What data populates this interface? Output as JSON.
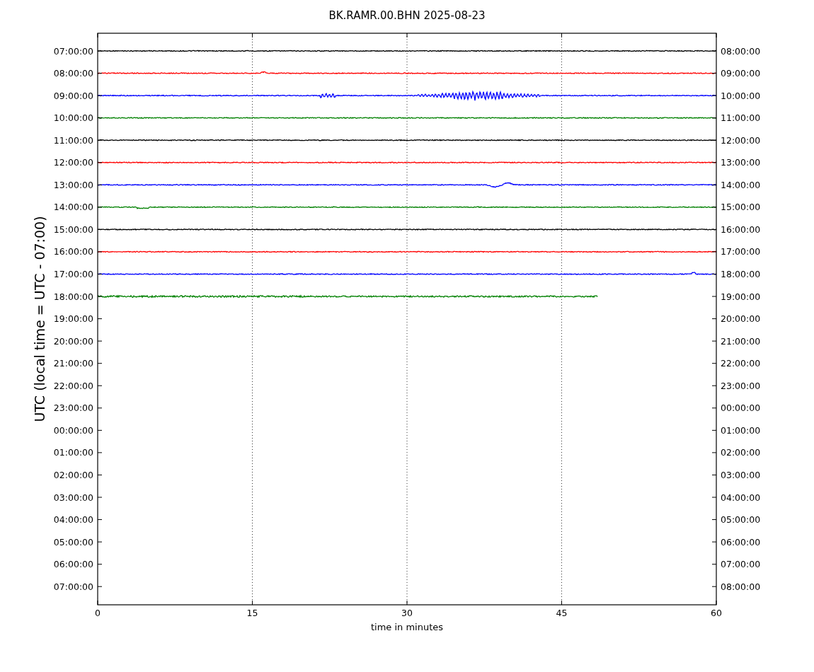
{
  "title": "BK.RAMR.00.BHN 2025-08-23",
  "ylabel": "UTC (local time = UTC - 07:00)",
  "xlabel": "time in minutes",
  "xticks": [
    "0",
    "15",
    "30",
    "45",
    "60"
  ],
  "left_labels": [
    "07:00:00",
    "08:00:00",
    "09:00:00",
    "10:00:00",
    "11:00:00",
    "12:00:00",
    "13:00:00",
    "14:00:00",
    "15:00:00",
    "16:00:00",
    "17:00:00",
    "18:00:00",
    "19:00:00",
    "20:00:00",
    "21:00:00",
    "22:00:00",
    "23:00:00",
    "00:00:00",
    "01:00:00",
    "02:00:00",
    "03:00:00",
    "04:00:00",
    "05:00:00",
    "06:00:00",
    "07:00:00"
  ],
  "right_labels": [
    "08:00:00",
    "09:00:00",
    "10:00:00",
    "11:00:00",
    "12:00:00",
    "13:00:00",
    "14:00:00",
    "15:00:00",
    "16:00:00",
    "17:00:00",
    "18:00:00",
    "19:00:00",
    "20:00:00",
    "21:00:00",
    "22:00:00",
    "23:00:00",
    "00:00:00",
    "01:00:00",
    "02:00:00",
    "03:00:00",
    "04:00:00",
    "05:00:00",
    "06:00:00",
    "07:00:00",
    "08:00:00"
  ],
  "traces": [
    {
      "color": "#000000",
      "kind": "quiet",
      "level": 1
    },
    {
      "color": "#ff0000",
      "kind": "spike",
      "level": 1
    },
    {
      "color": "#0000ff",
      "kind": "quake",
      "level": 1
    },
    {
      "color": "#008000",
      "kind": "quiet",
      "level": 1
    },
    {
      "color": "#000000",
      "kind": "quiet",
      "level": 1
    },
    {
      "color": "#ff0000",
      "kind": "quiet",
      "level": 1
    },
    {
      "color": "#0000ff",
      "kind": "bump",
      "level": 1
    },
    {
      "color": "#008000",
      "kind": "step",
      "level": 1
    },
    {
      "color": "#000000",
      "kind": "quiet",
      "level": 1
    },
    {
      "color": "#ff0000",
      "kind": "quiet",
      "level": 1
    },
    {
      "color": "#0000ff",
      "kind": "blips",
      "level": 1
    },
    {
      "color": "#008000",
      "kind": "ripple",
      "level": 0.808
    }
  ]
}
